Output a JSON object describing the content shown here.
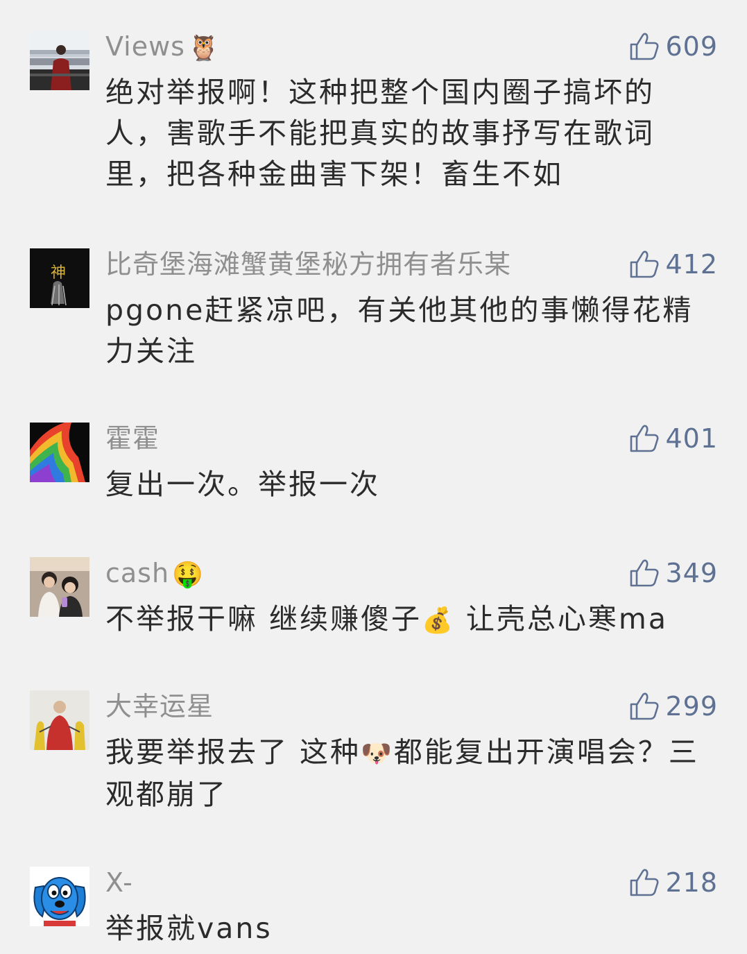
{
  "comments": [
    {
      "username": "Views",
      "username_emoji": "🦉",
      "likes": "609",
      "text": "绝对举报啊！这种把整个国内圈子搞坏的人，害歌手不能把真实的故事抒写在歌词里，把各种金曲害下架！畜生不如"
    },
    {
      "username": "比奇堡海滩蟹黄堡秘方拥有者乐某",
      "likes": "412",
      "text": "pgone赶紧凉吧，有关他其他的事懒得花精力关注",
      "avatar_text": "神"
    },
    {
      "username": "霍霍",
      "likes": "401",
      "text": "复出一次。举报一次"
    },
    {
      "username": "cash",
      "username_emoji": "🤑",
      "likes": "349",
      "text_part1": "不举报干嘛 继续赚傻子",
      "text_emoji": "💰",
      "text_part2": " 让壳总心寒ma"
    },
    {
      "username": "大幸运星",
      "likes": "299",
      "text_part1": "我要举报去了 这种",
      "text_emoji": "🐶",
      "text_part2": "都能复出开演唱会？三观都崩了"
    },
    {
      "username": "X-",
      "likes": "218",
      "text": "举报就vans"
    }
  ],
  "icons": {
    "like": "thumbs-up-outline-icon"
  },
  "colors": {
    "background": "#f1f1f1",
    "username": "#8f8f8f",
    "like": "#5e7192",
    "text": "#2b2b2b"
  }
}
